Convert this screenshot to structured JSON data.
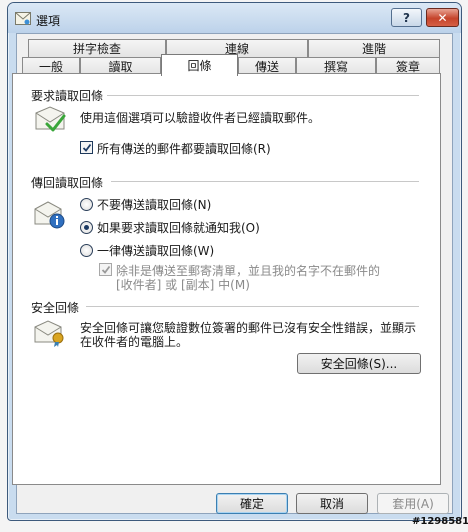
{
  "window": {
    "title": "選項"
  },
  "titlebar": {
    "help": "?",
    "close": "✕"
  },
  "tabs": {
    "row1": [
      {
        "label": "拼字檢查"
      },
      {
        "label": "連線"
      },
      {
        "label": "進階"
      }
    ],
    "row2": [
      {
        "label": "一般"
      },
      {
        "label": "讀取"
      },
      {
        "label": "回條",
        "active": true
      },
      {
        "label": "傳送"
      },
      {
        "label": "撰寫"
      },
      {
        "label": "簽章"
      }
    ]
  },
  "request": {
    "heading": "要求讀取回條",
    "description": "使用這個選項可以驗證收件者已經讀取郵件。",
    "checkbox_label": "所有傳送的郵件都要讀取回條(R)",
    "checkbox_checked": true
  },
  "return": {
    "heading": "傳回讀取回條",
    "options": [
      {
        "label": "不要傳送讀取回條(N)",
        "selected": false
      },
      {
        "label": "如果要求讀取回條就通知我(O)",
        "selected": true
      },
      {
        "label": "一律傳送讀取回條(W)",
        "selected": false
      }
    ],
    "sub_checkbox_line1": "除非是傳送至郵寄清單，並且我的名字不在郵件的",
    "sub_checkbox_line2": "[收件者] 或 [副本] 中(M)",
    "sub_checkbox_checked": true
  },
  "secure": {
    "heading": "安全回條",
    "description_line1": "安全回條可讓您驗證數位簽署的郵件已沒有安全性錯誤，並顯示",
    "description_line2": "在收件者的電腦上。",
    "button": "安全回條(S)..."
  },
  "footer": {
    "ok": "確定",
    "cancel": "取消",
    "apply": "套用(A)"
  },
  "watermark": "#1298581",
  "colors": {
    "accent": "#3c7fb1",
    "titlebar": "#bcd2ea",
    "check_green": "#3aa63a"
  }
}
